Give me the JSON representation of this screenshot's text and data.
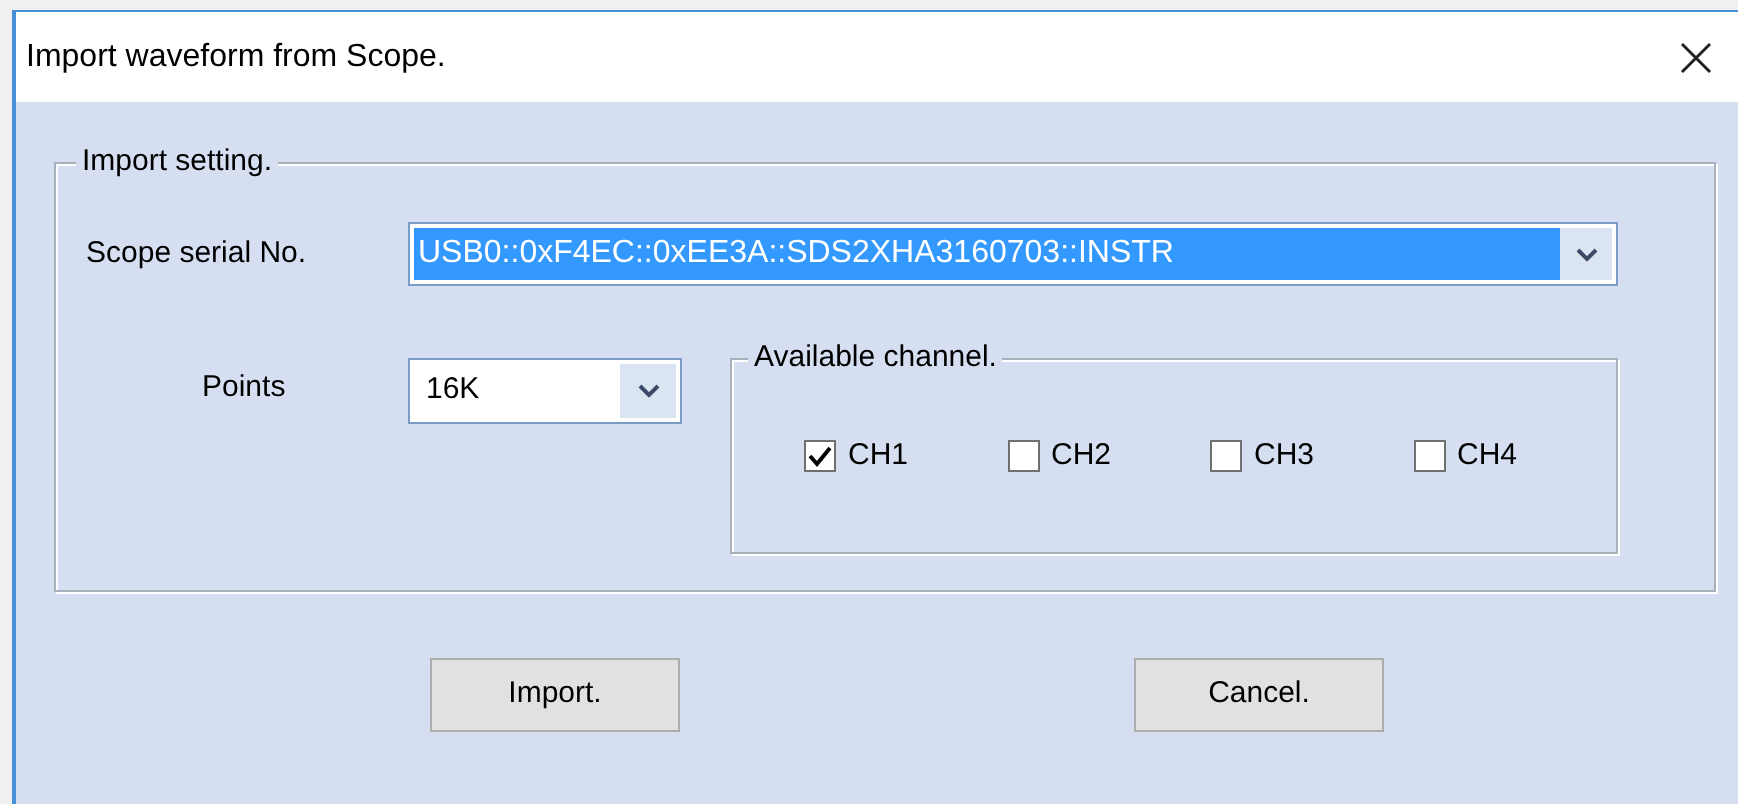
{
  "window": {
    "title": "Import waveform from Scope."
  },
  "import_setting": {
    "title": "Import setting.",
    "serial_label": "Scope serial No.",
    "serial_value": "USB0::0xF4EC::0xEE3A::SDS2XHA3160703::INSTR",
    "serial_selected": true,
    "points_label": "Points",
    "points_value": "16K"
  },
  "available_channel": {
    "title": "Available channel.",
    "channels": [
      {
        "label": "CH1",
        "checked": true
      },
      {
        "label": "CH2",
        "checked": false
      },
      {
        "label": "CH3",
        "checked": false
      },
      {
        "label": "CH4",
        "checked": false
      }
    ]
  },
  "buttons": [
    {
      "label": "Import."
    },
    {
      "label": "Cancel."
    }
  ]
}
